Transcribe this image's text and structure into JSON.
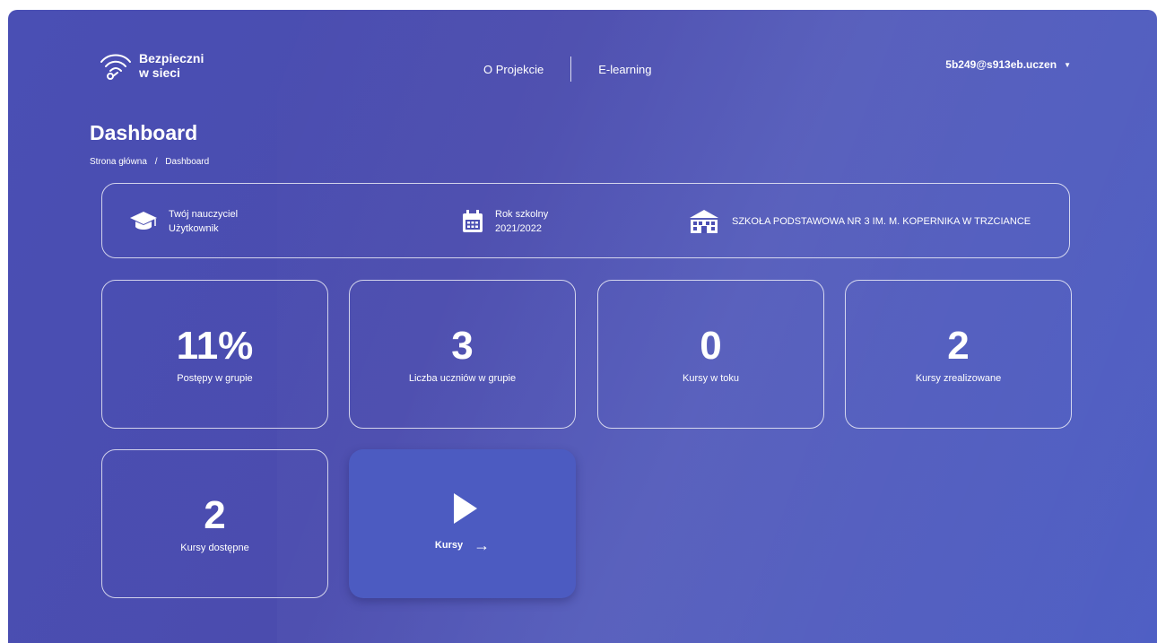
{
  "header": {
    "logo_line1": "Bezpieczni",
    "logo_line2": "w sieci",
    "nav": [
      {
        "label": "O Projekcie"
      },
      {
        "label": "E-learning"
      }
    ],
    "user": "5b249@s913eb.uczen"
  },
  "page": {
    "title": "Dashboard",
    "breadcrumb": {
      "home": "Strona główna",
      "sep": "/",
      "current": "Dashboard"
    }
  },
  "info": {
    "teacher_label": "Twój nauczyciel",
    "teacher_value": "Użytkownik",
    "year_label": "Rok szkolny",
    "year_value": "2021/2022",
    "school": "SZKOŁA PODSTAWOWA NR 3 IM. M. KOPERNIKA W TRZCIANCE"
  },
  "stats": [
    {
      "value": "11%",
      "label": "Postępy w grupie"
    },
    {
      "value": "3",
      "label": "Liczba uczniów w grupie"
    },
    {
      "value": "0",
      "label": "Kursy w toku"
    },
    {
      "value": "2",
      "label": "Kursy zrealizowane"
    },
    {
      "value": "2",
      "label": "Kursy dostępne"
    }
  ],
  "cta": {
    "label": "Kursy",
    "arrow": "→"
  },
  "icons": {
    "logo": "wifi-icon",
    "teacher": "graduation-cap-icon",
    "year": "calendar-icon",
    "school": "school-building-icon",
    "caret": "caret-down-icon",
    "cta": "play-icon"
  }
}
